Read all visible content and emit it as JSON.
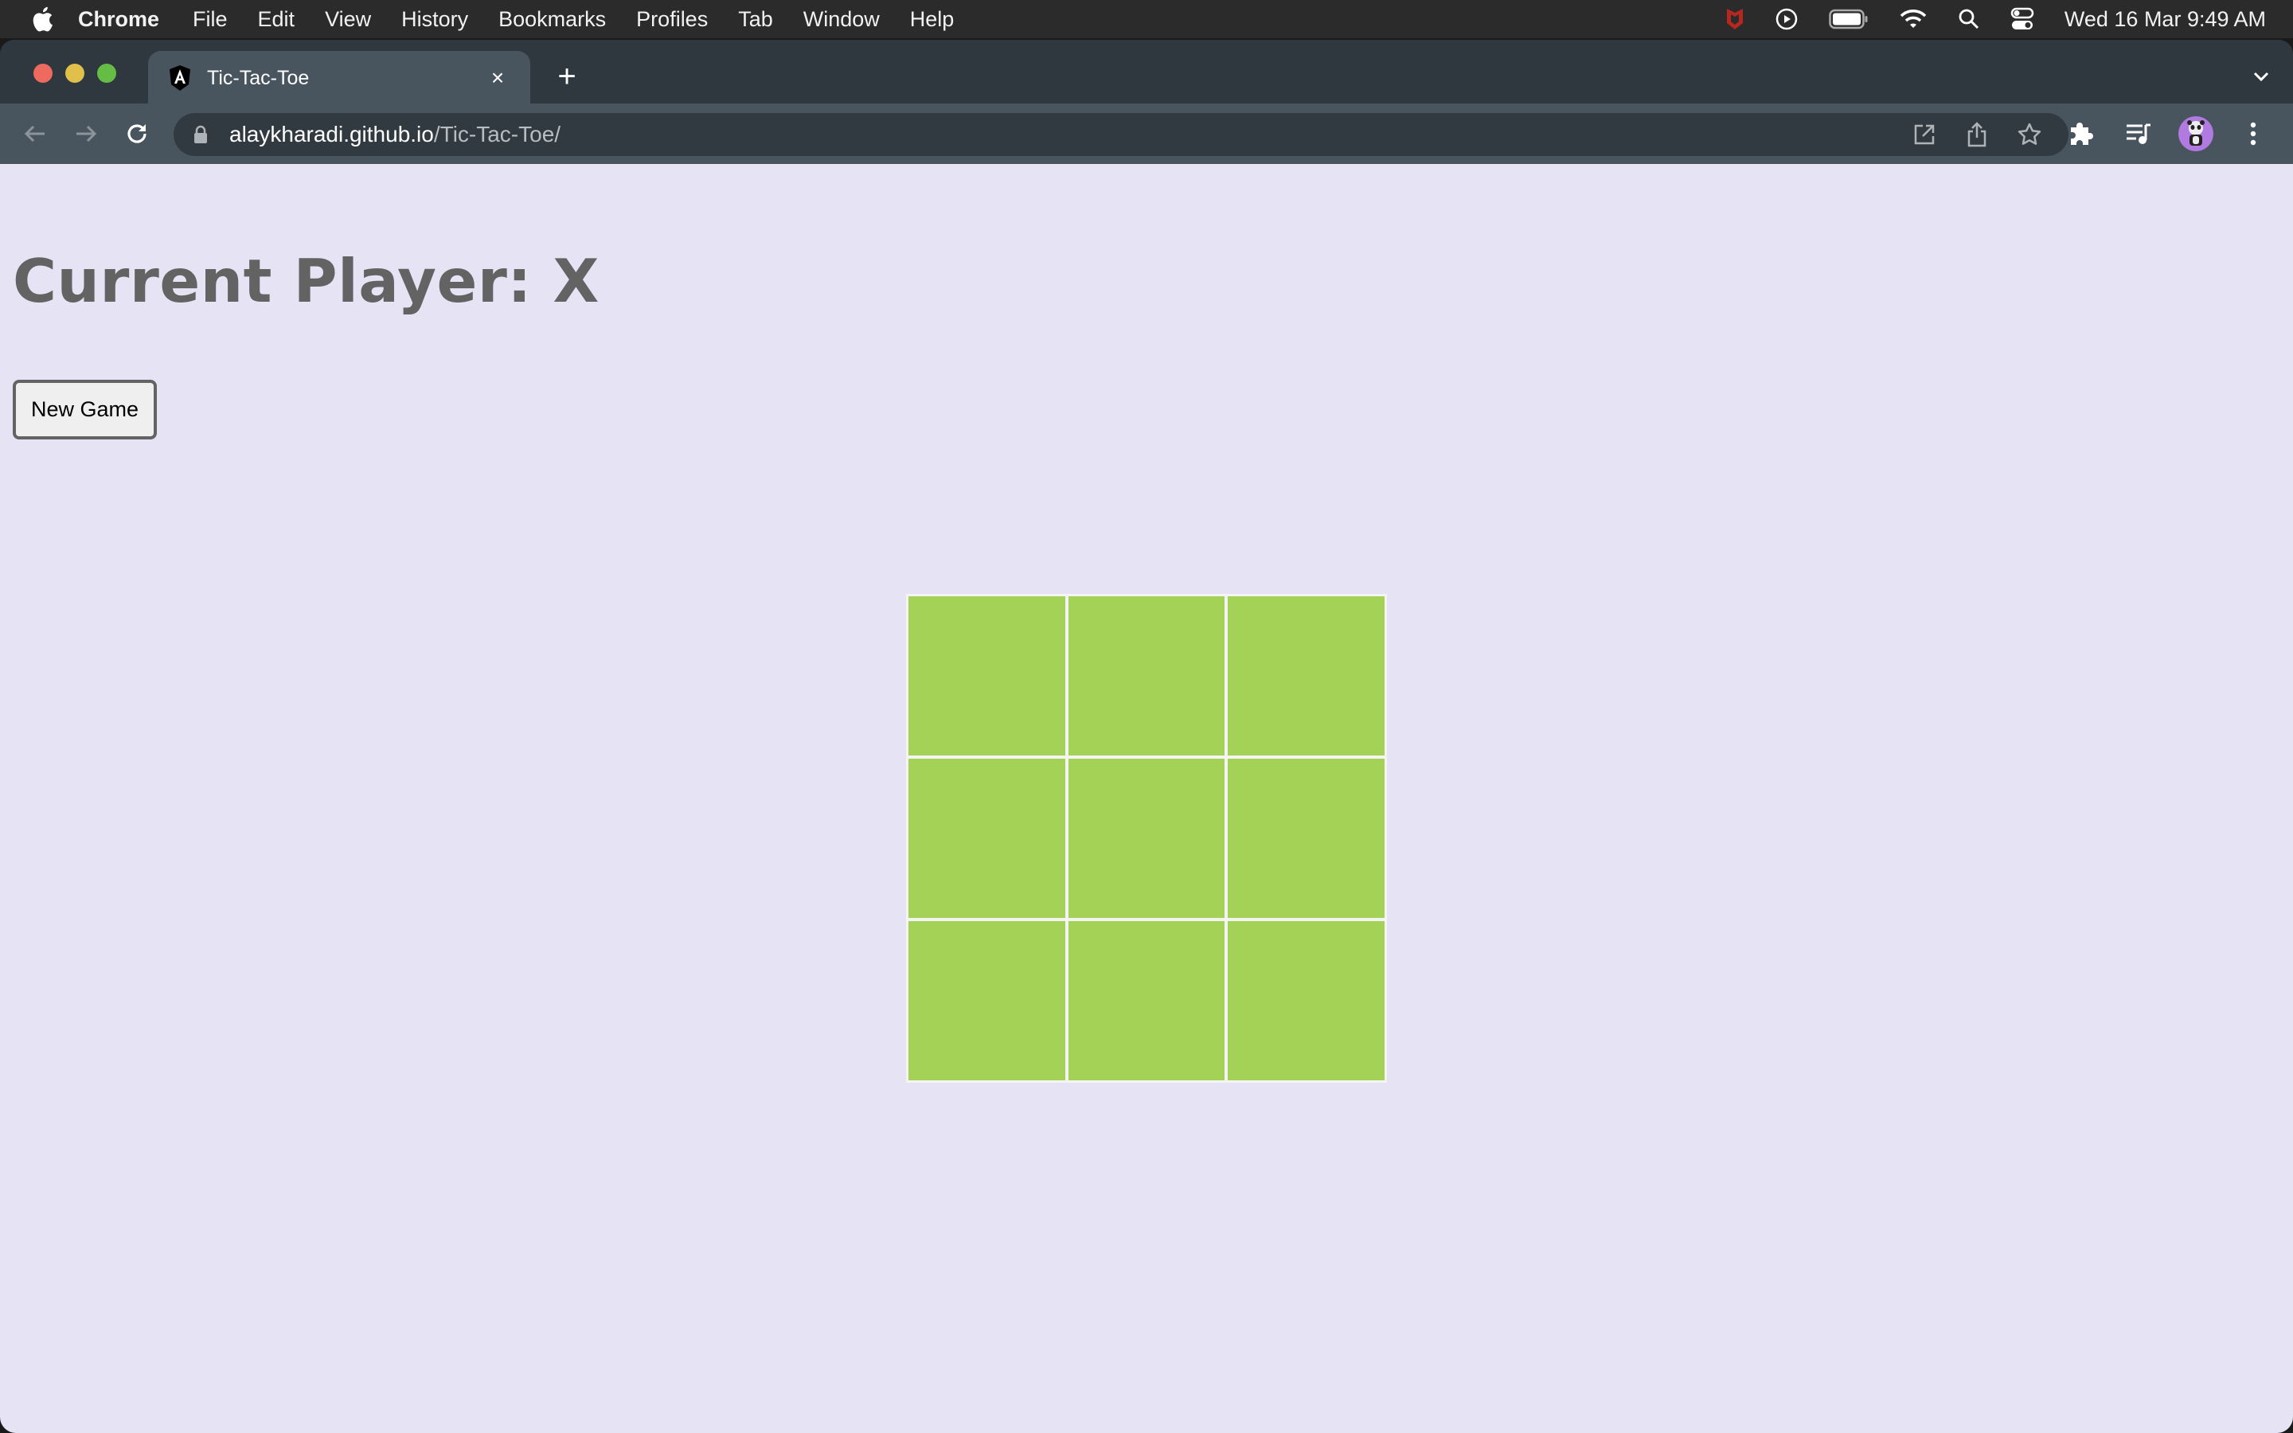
{
  "menubar": {
    "app_name": "Chrome",
    "items": [
      "File",
      "Edit",
      "View",
      "History",
      "Bookmarks",
      "Profiles",
      "Tab",
      "Window",
      "Help"
    ],
    "status_icons": [
      "mcafee-shield-icon",
      "play-circle-icon",
      "battery-icon",
      "wifi-icon",
      "spotlight-search-icon",
      "control-center-icon"
    ],
    "clock": "Wed 16 Mar  9:49 AM"
  },
  "browser": {
    "tab": {
      "title": "Tic-Tac-Toe",
      "favicon": "angular-icon",
      "close_glyph": "×"
    },
    "new_tab_glyph": "+",
    "url_host": "alaykharadi.github.io",
    "url_path": "/Tic-Tac-Toe/",
    "omnibox_actions": [
      "open-in-new-icon",
      "share-icon",
      "bookmark-star-icon"
    ],
    "toolbar_actions": [
      "extensions-icon",
      "media-queue-icon",
      "profile-avatar",
      "menu-kebab-icon"
    ]
  },
  "page": {
    "heading": "Current Player: X",
    "new_game_label": "New Game",
    "board": {
      "rows": 3,
      "cols": 3,
      "cells": [
        "",
        "",
        "",
        "",
        "",
        "",
        "",
        "",
        ""
      ],
      "cell_color": "#a3d257",
      "grid_line_color": "#f4f4f4"
    },
    "background_color": "#e6e3f4"
  }
}
